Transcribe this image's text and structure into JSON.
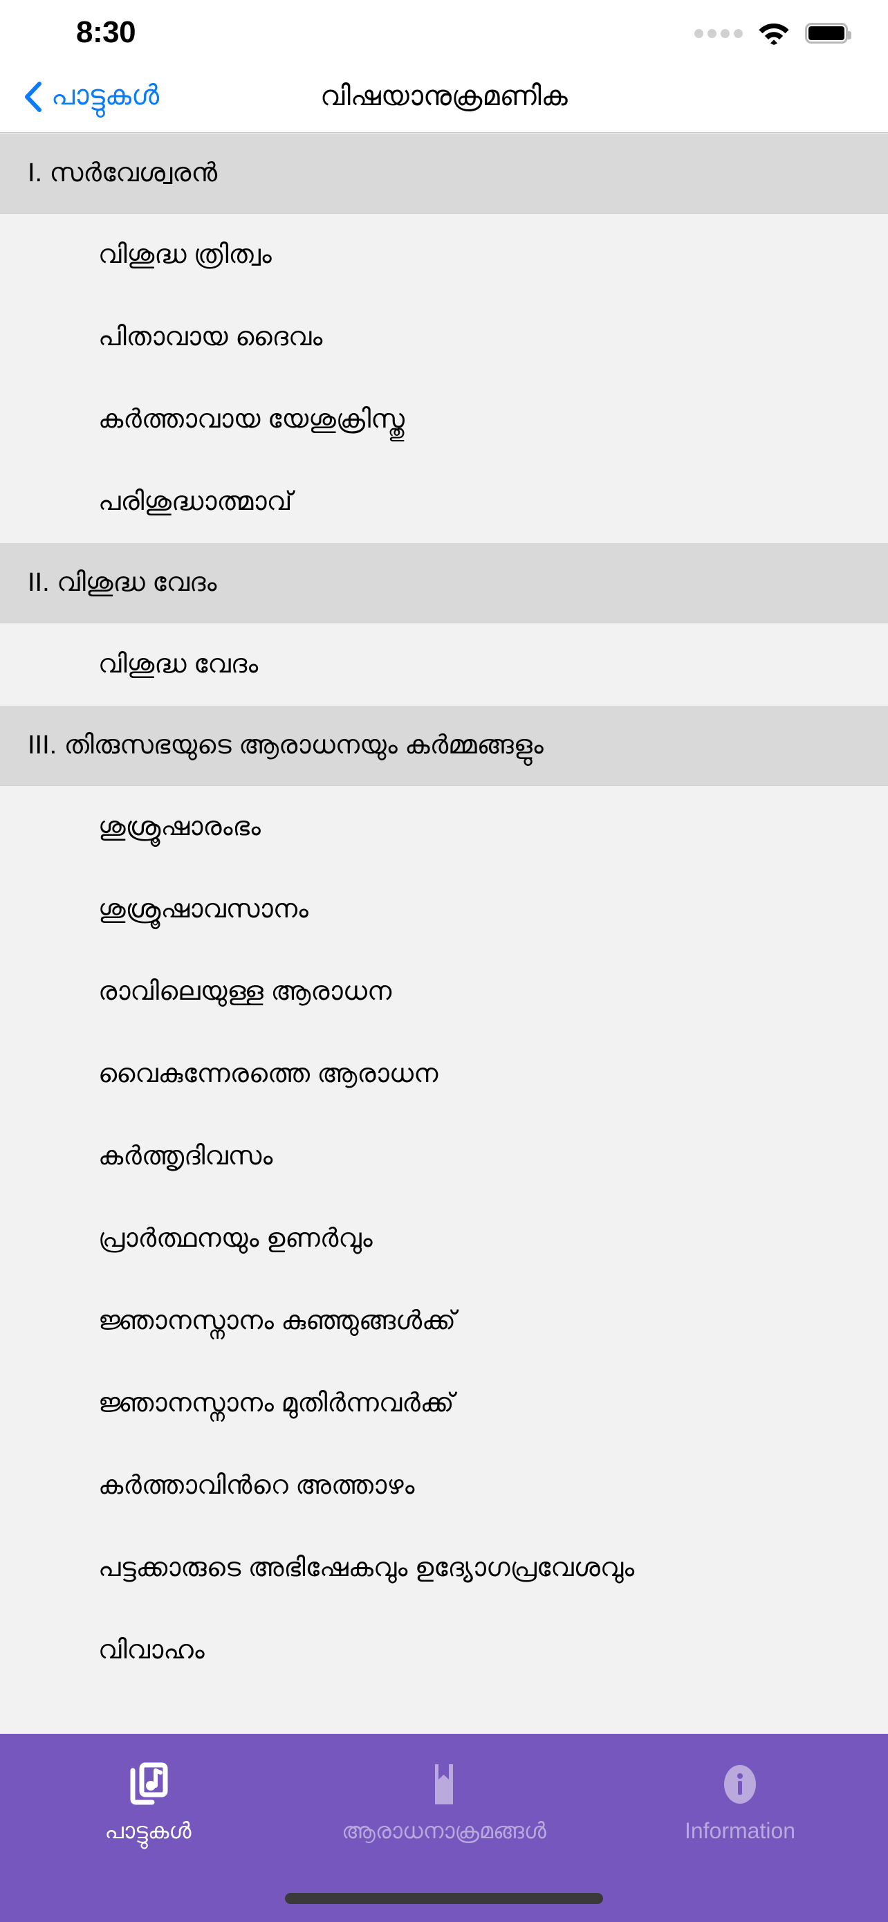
{
  "status_bar": {
    "time": "8:30",
    "icons": [
      "signal-dots-icon",
      "wifi-icon",
      "battery-icon"
    ]
  },
  "nav_bar": {
    "back_label": "പാട്ടുകൾ",
    "back_icon": "chevron-left-icon",
    "title": "വിഷയാനുക്രമണിക",
    "accent_color": "#0a7cf7"
  },
  "list": {
    "sections": [
      {
        "header": "I. സർവേശ്വരൻ",
        "items": [
          "വിശുദ്ധ ത്രിത്വം",
          "പിതാവായ ദൈവം",
          "കർത്താവായ യേശുക്രിസ്തു",
          "പരിശുദ്ധാത്മാവ്"
        ]
      },
      {
        "header": "II. വിശുദ്ധ വേദം",
        "items": [
          "വിശുദ്ധ വേദം"
        ]
      },
      {
        "header": "III. തിരുസഭയുടെ ആരാധനയും കർമ്മങ്ങളും",
        "items": [
          "ശുശ്രൂഷാരംഭം",
          "ശുശ്രൂഷാവസാനം",
          "രാവിലെയുള്ള ആരാധന",
          "വൈകുന്നേരത്തെ ആരാധന",
          "കർത്തൃദിവസം",
          "പ്രാർത്ഥനയും ഉണർവും",
          "ജ്ഞാനസ്നാനം കുഞ്ഞുങ്ങൾക്ക്",
          "ജ്ഞാനസ്നാനം മുതിർന്നവർക്ക്",
          "കർത്താവിൻറെ അത്താഴം",
          "പട്ടക്കാരുടെ അഭിഷേകവും ഉദ്യോഗപ്രവേശവും",
          "വിവാഹം"
        ]
      }
    ]
  },
  "tab_bar": {
    "background_color": "#7557bd",
    "active_color": "#ffffff",
    "inactive_color": "#b9a9dd",
    "tabs": [
      {
        "label": "പാട്ടുകൾ",
        "icon": "music-album-icon",
        "active": true
      },
      {
        "label": "ആരാധനാക്രമങ്ങൾ",
        "icon": "bookmark-book-icon",
        "active": false
      },
      {
        "label": "Information",
        "icon": "info-circle-icon",
        "active": false
      }
    ]
  }
}
